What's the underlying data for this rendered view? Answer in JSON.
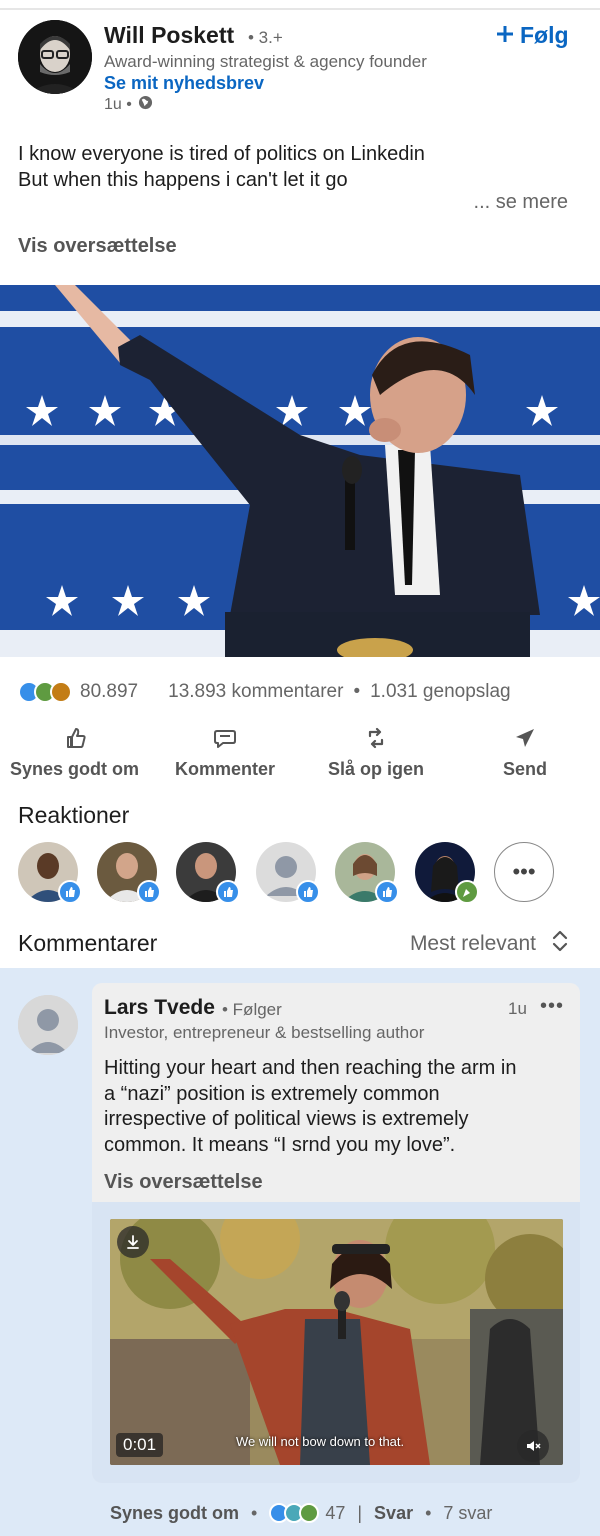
{
  "post": {
    "author": {
      "name": "Will Poskett",
      "degree": "• 3.+",
      "headline": "Award-winning strategist & agency founder",
      "newsletter_link": "Se mit nyhedsbrev",
      "time": "1u •"
    },
    "follow_label": "Følg",
    "text_lines": [
      "I know everyone is tired of politics on Linkedin",
      "But when this happens i can't let it go"
    ],
    "see_more": "... se mere",
    "translate_label": "Vis oversættelse"
  },
  "social": {
    "reaction_count": "80.897",
    "comments": "13.893 kommentarer",
    "separator": "•",
    "reposts": "1.031 genopslag"
  },
  "actions": {
    "like": "Synes godt om",
    "comment": "Kommenter",
    "repost": "Slå op igen",
    "send": "Send"
  },
  "reactions": {
    "heading": "Reaktioner",
    "more_label": "•••"
  },
  "comments_section": {
    "heading": "Kommentarer",
    "sort_label": "Mest relevant"
  },
  "comment": {
    "author": "Lars Tvede",
    "follow_status": "• Følger",
    "time": "1u",
    "menu": "•••",
    "headline": "Investor, entrepreneur & bestselling author",
    "text_lines": [
      "Hitting your heart and then reaching the arm in",
      "a “nazi” position is extremely common",
      "irrespective of political views is extremely",
      "common. It means “I srnd you my love”."
    ],
    "translate_label": "Vis oversættelse",
    "video": {
      "timestamp": "0:01",
      "caption": "We will not bow down to that."
    },
    "actions": {
      "like": "Synes godt om",
      "dot": "•",
      "reaction_count": "47",
      "reply": "Svar",
      "dot2": "•",
      "replies": "7 svar"
    }
  },
  "colors": {
    "linkedin_blue": "#0a66c2",
    "comment_background": "#dde9f7",
    "bubble_background": "#efefef"
  }
}
